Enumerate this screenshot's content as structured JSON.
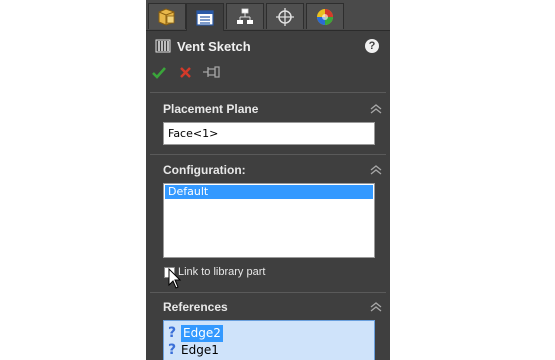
{
  "panel": {
    "tabs": [
      {
        "icon": "feature-manager-icon"
      },
      {
        "icon": "property-manager-icon"
      },
      {
        "icon": "configuration-manager-icon"
      },
      {
        "icon": "dimxpert-manager-icon"
      },
      {
        "icon": "display-manager-icon"
      }
    ],
    "header": {
      "title": "Vent Sketch",
      "help": "?"
    },
    "placement_plane": {
      "title": "Placement Plane",
      "value": "Face<1>"
    },
    "configuration": {
      "title": "Configuration:",
      "items": [
        "Default"
      ]
    },
    "link_checkbox": {
      "label": "Link to library part",
      "checked": false
    },
    "references": {
      "title": "References",
      "items": [
        {
          "mark": "?",
          "label": "Edge2",
          "selected": true
        },
        {
          "mark": "?",
          "label": "Edge1",
          "selected": false
        }
      ]
    }
  },
  "colors": {
    "panel_bg": "#3f3f3f",
    "accent_select": "#3399ff",
    "ok_green": "#3aa63a",
    "cancel_red": "#d23a2a"
  }
}
